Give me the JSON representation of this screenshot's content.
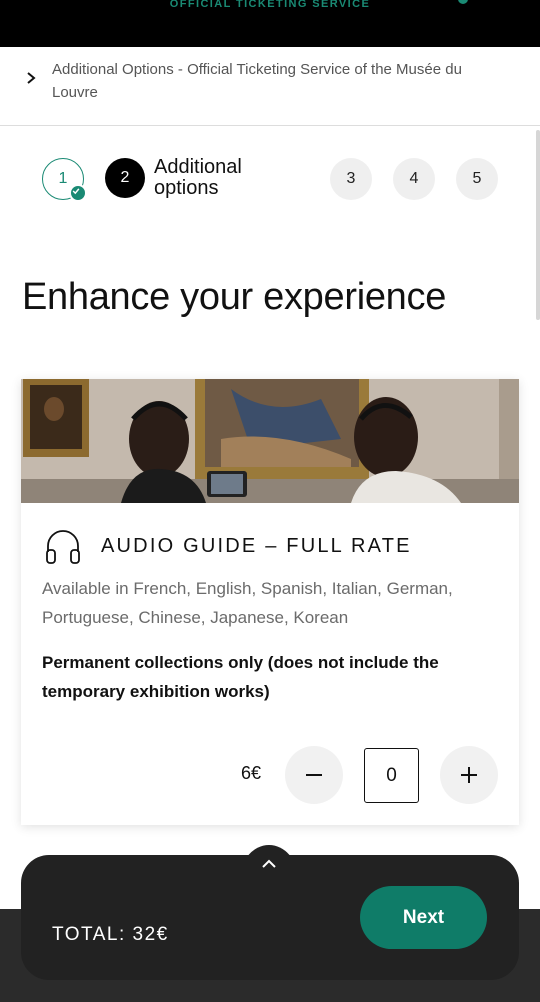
{
  "header": {
    "service_label": "OFFICIAL TICKETING SERVICE"
  },
  "breadcrumb": {
    "text": "Additional Options - Official Ticketing Service of the Musée du Louvre"
  },
  "stepper": {
    "steps": [
      {
        "number": "1",
        "state": "completed"
      },
      {
        "number": "2",
        "state": "current",
        "label": "Additional options"
      },
      {
        "number": "3",
        "state": "upcoming"
      },
      {
        "number": "4",
        "state": "upcoming"
      },
      {
        "number": "5",
        "state": "upcoming"
      }
    ],
    "current_label_line1": "Additional",
    "current_label_line2": "options"
  },
  "main": {
    "heading": "Enhance your experience"
  },
  "product": {
    "icon": "headphones-icon",
    "title": "AUDIO GUIDE – FULL RATE",
    "description": "Available in French, English, Spanish, Italian, German, Portuguese, Chinese, Japanese, Korean",
    "note": "Permanent collections only (does not include the temporary exhibition works)",
    "price": "6€",
    "quantity": "0"
  },
  "footer": {
    "total": "TOTAL: 32€",
    "next_label": "Next"
  },
  "colors": {
    "accent": "#0f7c68",
    "dark": "#222222"
  }
}
